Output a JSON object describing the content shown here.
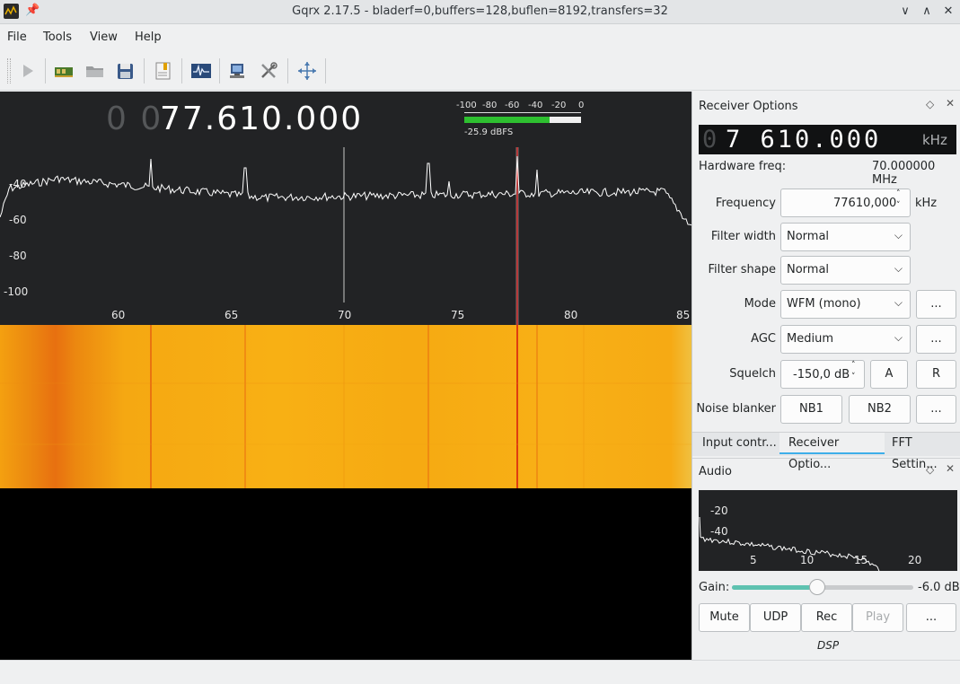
{
  "window": {
    "title": "Gqrx 2.17.5 - bladerf=0,buffers=128,buflen=8192,transfers=32",
    "controls": [
      "∨",
      "∧",
      "✕"
    ]
  },
  "menubar": {
    "items": [
      "File",
      "Tools",
      "View",
      "Help"
    ]
  },
  "toolbar": {
    "icons": [
      "play-icon",
      "hardware-icon",
      "open-icon",
      "save-icon",
      "bookmark-icon",
      "iq-tool-icon",
      "remote-control-icon",
      "settings-icon",
      "center-fft-icon"
    ]
  },
  "plot": {
    "freq_display_dim": "0 0",
    "freq_display": "77.610.000",
    "meter_ticks": [
      "-100",
      "-80",
      "-60",
      "-40",
      "-20",
      "0"
    ],
    "meter_level": 0.73,
    "meter_readout": "-25.9 dBFS",
    "y_ticks": [
      "-40",
      "-60",
      "-80",
      "-100"
    ],
    "x_ticks": [
      "60",
      "65",
      "70",
      "75",
      "80",
      "85"
    ],
    "colors": {
      "trace": "#ffffff",
      "filter": "#ff3030",
      "center": "#c8c8c8"
    }
  },
  "receiver_options": {
    "title": "Receiver Options",
    "lcd_dim": "0",
    "lcd_value": "7 610.000",
    "lcd_unit": "kHz",
    "hardware_freq_label": "Hardware freq:",
    "hardware_freq_value": "70.000000 MHz",
    "frequency_label": "Frequency",
    "frequency_value": "77610,000",
    "frequency_unit": "kHz",
    "filter_width_label": "Filter width",
    "filter_width_value": "Normal",
    "filter_shape_label": "Filter shape",
    "filter_shape_value": "Normal",
    "mode_label": "Mode",
    "mode_value": "WFM (mono)",
    "agc_label": "AGC",
    "agc_value": "Medium",
    "squelch_label": "Squelch",
    "squelch_value": "-150,0 dB",
    "squelch_a": "A",
    "squelch_r": "R",
    "nb_label": "Noise blanker",
    "nb1": "NB1",
    "nb2": "NB2",
    "more": "...",
    "tabs": [
      "Input contr...",
      "Receiver Optio...",
      "FFT Settin..."
    ]
  },
  "audio": {
    "title": "Audio",
    "y_ticks": [
      "-20",
      "-40"
    ],
    "x_ticks": [
      "5",
      "10",
      "15",
      "20"
    ],
    "gain_label": "Gain:",
    "gain_value": "-6.0 dB",
    "gain_level": 0.47,
    "buttons": [
      "Mute",
      "UDP",
      "Rec",
      "Play",
      "..."
    ],
    "dsp_label": "DSP"
  }
}
